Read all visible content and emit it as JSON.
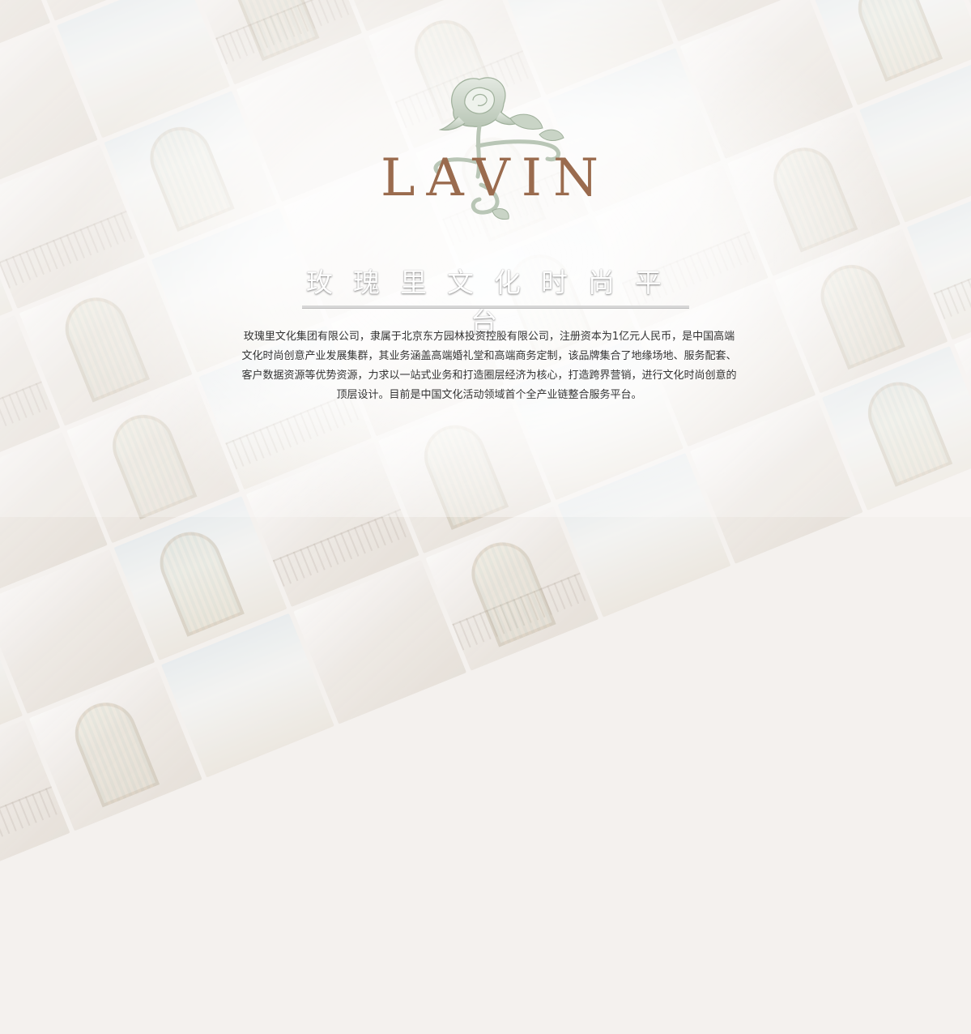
{
  "brand": {
    "logo_text": "LAVIN",
    "emblem": "rose-icon"
  },
  "slogan": "玫瑰里文化时尚平台",
  "description": "玫瑰里文化集团有限公司，隶属于北京东方园林投资控股有限公司，注册资本为1亿元人民币，是中国高端文化时尚创意产业发展集群，其业务涵盖高端婚礼堂和高端商务定制，该品牌集合了地缘场地、服务配套、客户数据资源等优势资源，力求以一站式业务和打造圈层经济为核心，打造跨界营销，进行文化时尚创意的顶层设计。目前是中国文化活动领域首个全产业链整合服务平台。",
  "colors": {
    "logo_brown": "#9a6b4e",
    "rose_green": "#c9d4c6",
    "background": "#f4f1ee"
  }
}
